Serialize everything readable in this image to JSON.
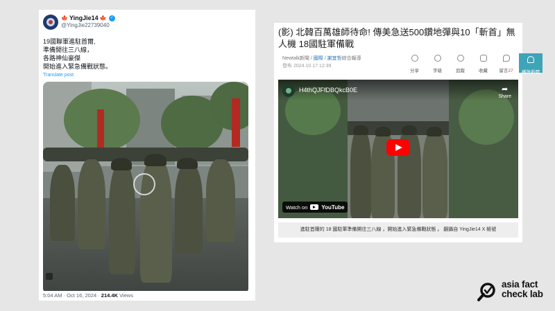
{
  "tweet": {
    "author_name": "YingJie14",
    "author_flag_left": "🍁",
    "author_flag_right": "🍁",
    "handle": "@YingJie22739040",
    "body_lines": [
      "19國聯軍進駐首爾,",
      "準備開往三八線，",
      "各路神仙豪傑",
      "開始進入緊急備戰狀態。"
    ],
    "translate_label": "Translate post",
    "timestamp": "5:04 AM · Oct 16, 2024 · ",
    "views_count": "214.4K",
    "views_label": " Views",
    "icons": {
      "verified": "verified-badge-icon",
      "flag": "maple-leaf-icon"
    },
    "colors": {
      "link": "#1d9bf0",
      "verified": "#1d9bf0"
    }
  },
  "news": {
    "title": "(影) 北韓百萬雄師待命! 傳美急送500鑽地彈與10「斬首」無人機 18國駐軍備戰",
    "source": "Newtalk新聞",
    "sep1": " / ",
    "category": "國際",
    "sep2": " / ",
    "author": "謝宜哲",
    "author_suffix": "綜合報導",
    "date": "發布 2024.10.17 12:39",
    "tools": [
      {
        "label": "分享",
        "icon": "share-icon"
      },
      {
        "label": "字級",
        "icon": "font-size-icon"
      },
      {
        "label": "追蹤",
        "icon": "follow-icon"
      },
      {
        "label": "收藏",
        "icon": "bookmark-icon"
      },
      {
        "label": "留言",
        "count": "27",
        "icon": "comment-icon"
      }
    ],
    "play_news_label": "播放新聞",
    "video": {
      "title": "H4thQJFfDBQkcB0E",
      "share_label": "Share",
      "watch_on": "Watch on",
      "youtube_label": "YouTube"
    },
    "caption": "進駐首爾的 18 國駐軍準備開往三八線 ，開始進入緊急備戰狀態 。 翻攝自 YingJie14 X 帳號",
    "colors": {
      "play_button": "#3fa4b8",
      "link": "#1e73be",
      "youtube_red": "#ff0000",
      "comment_count": "#dd3333"
    }
  },
  "logo": {
    "line1": "asia fact",
    "line2": "check lab"
  }
}
